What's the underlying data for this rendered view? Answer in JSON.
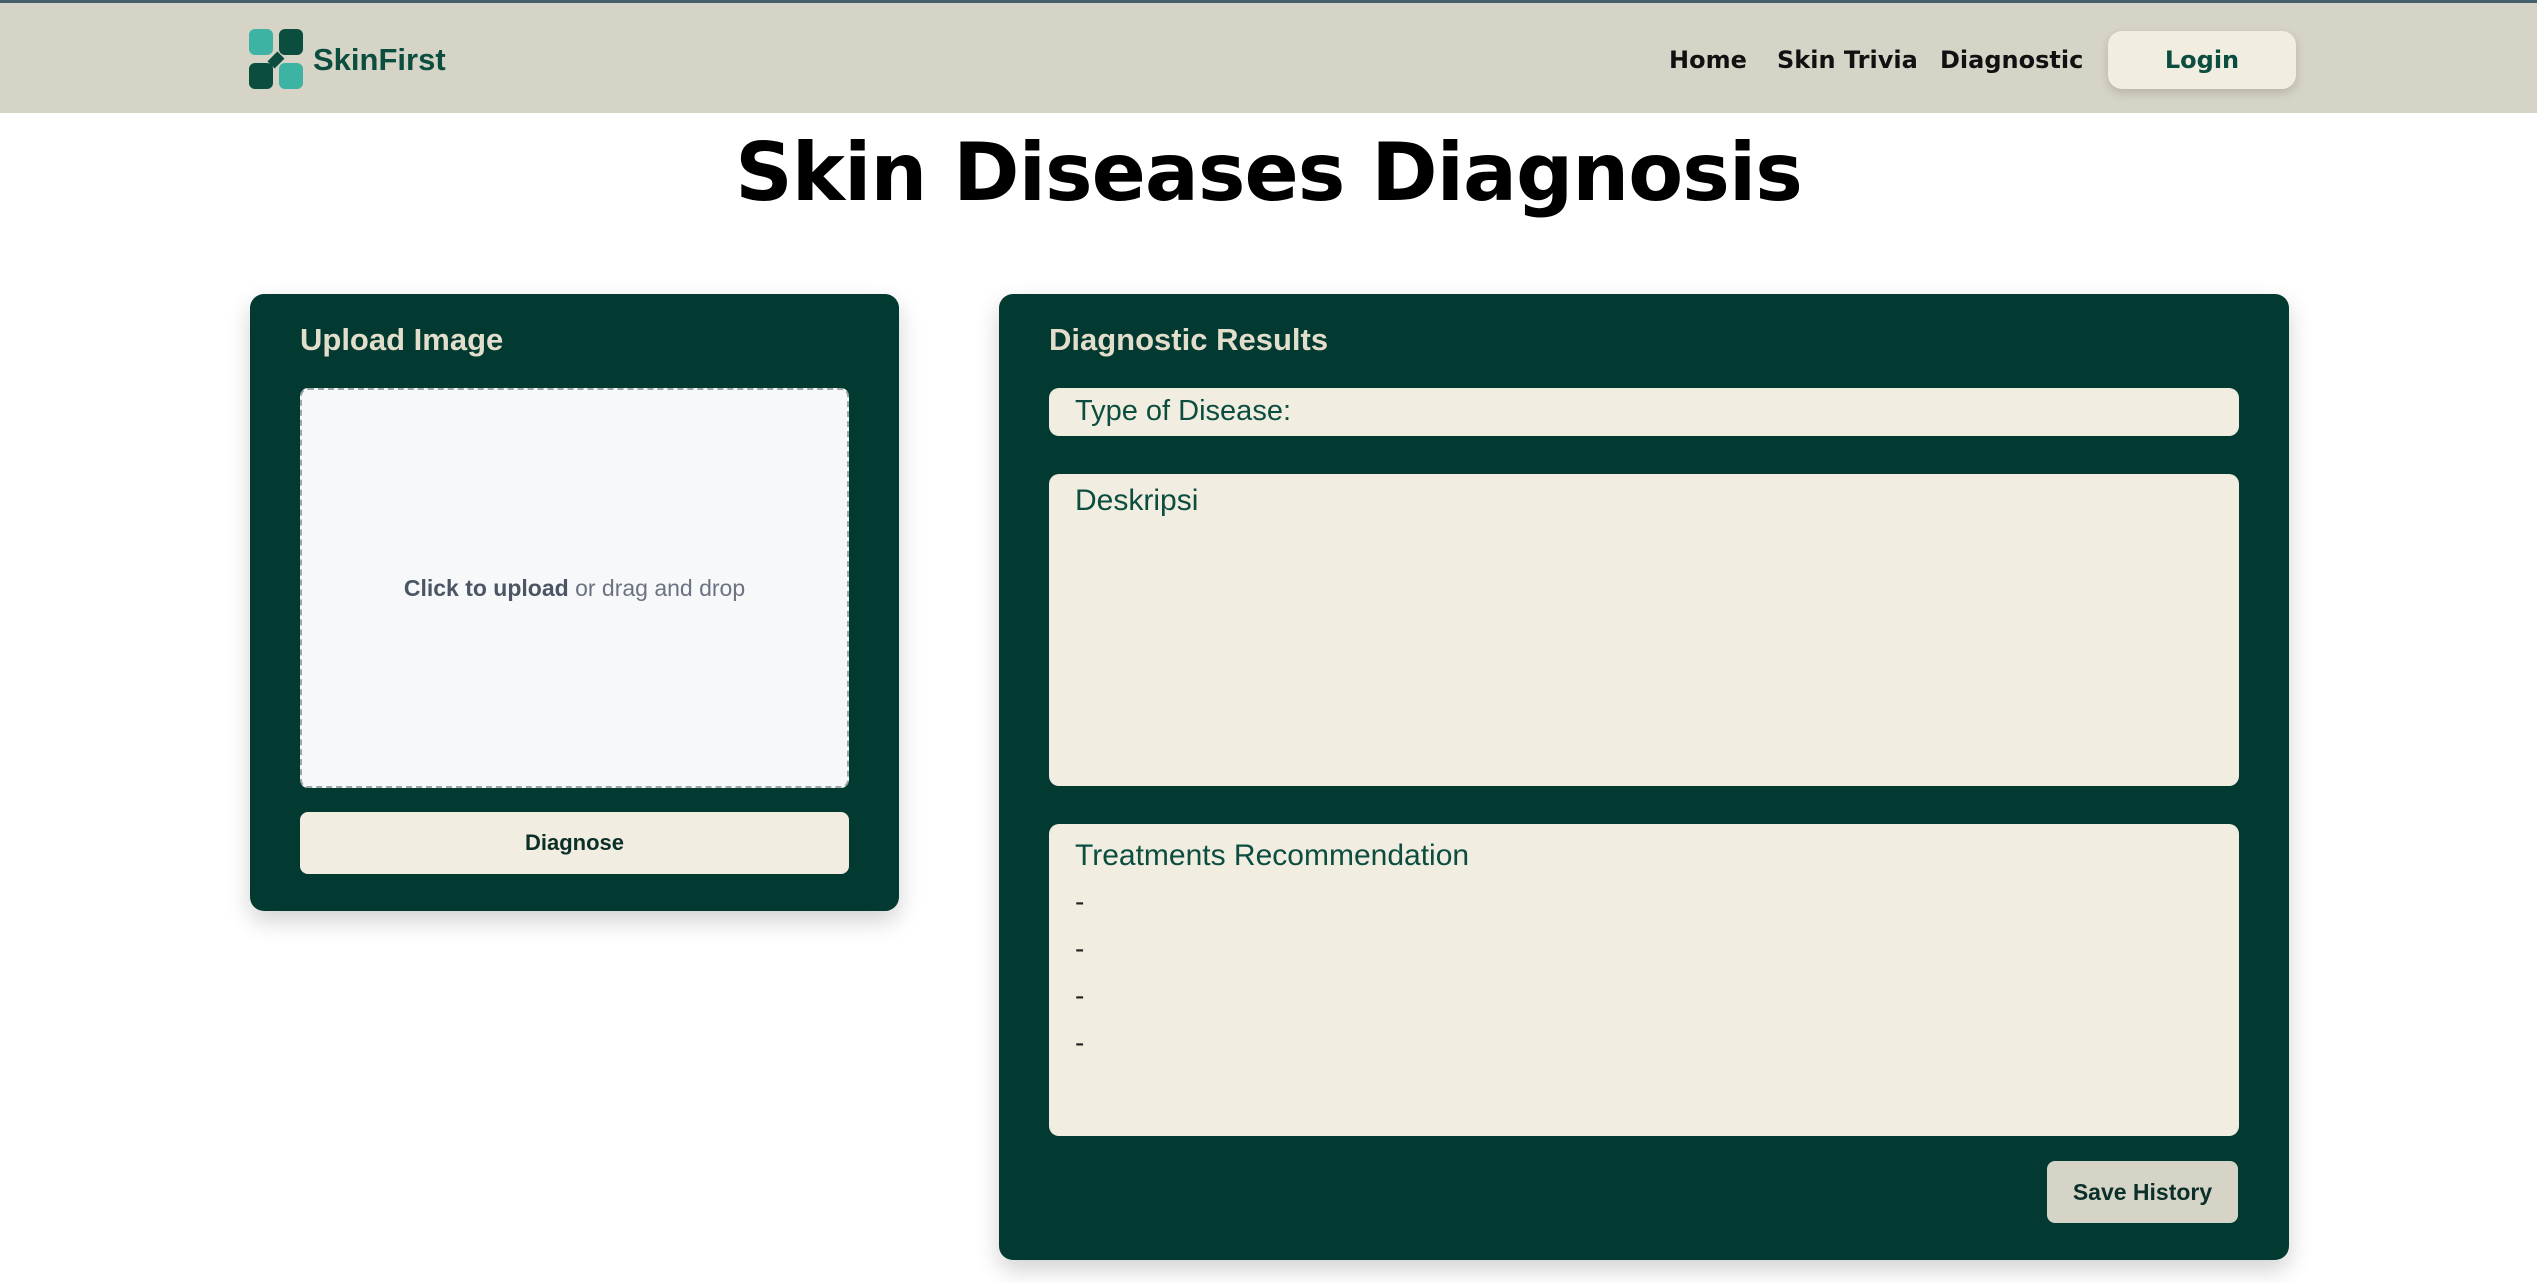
{
  "header": {
    "brand": "SkinFirst",
    "nav": [
      "Home",
      "Skin Trivia",
      "Diagnostic"
    ],
    "login_label": "Login"
  },
  "page": {
    "title": "Skin Diseases Diagnosis"
  },
  "upload": {
    "title": "Upload Image",
    "click_text": "Click to upload",
    "drag_text": " or drag and drop",
    "button_label": "Diagnose"
  },
  "results": {
    "title": "Diagnostic Results",
    "type_label": "Type of Disease:",
    "description_label": "Deskripsi",
    "treatments_label": "Treatments Recommendation",
    "treatments": [
      "-",
      "-",
      "-",
      "-"
    ],
    "save_label": "Save History"
  },
  "colors": {
    "navbar": "#d6d4c6",
    "panel": "#023a32",
    "card": "#f1ede0",
    "brand": "#0b4d3f",
    "accent": "#3db3a4"
  }
}
